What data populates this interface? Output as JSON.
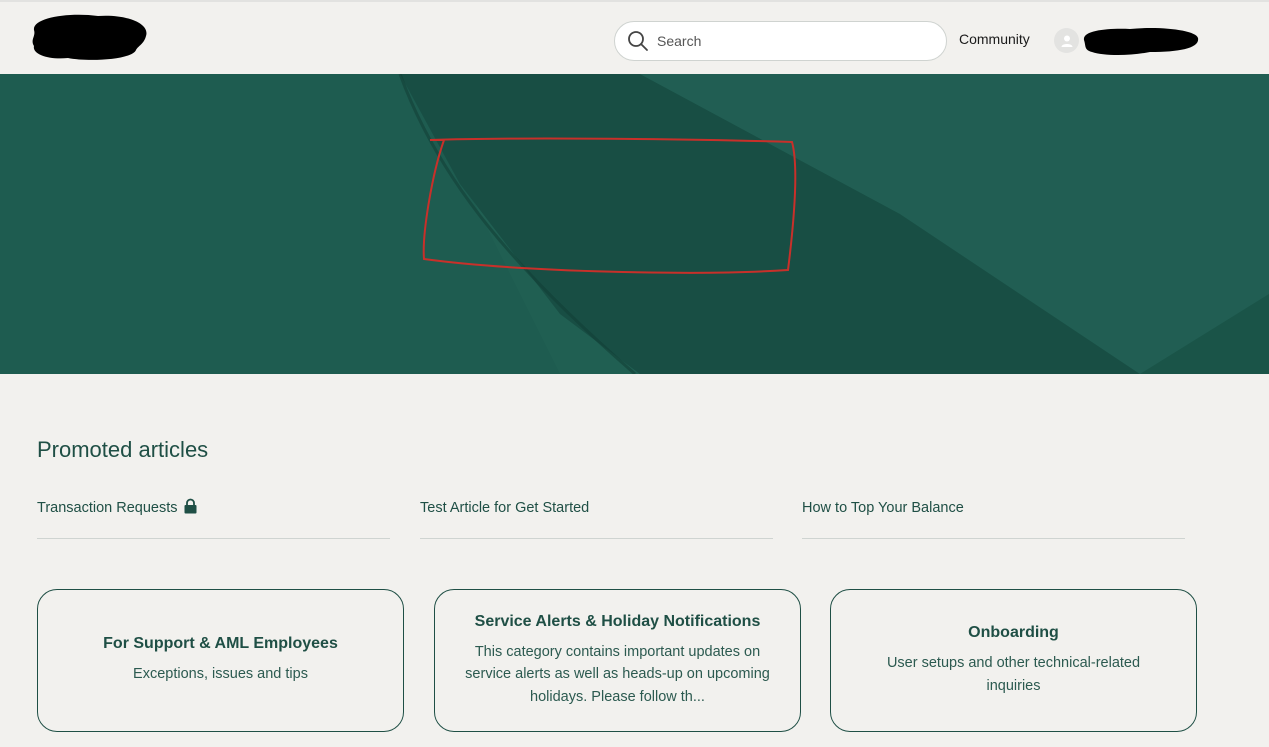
{
  "header": {
    "search_placeholder": "Search",
    "community_label": "Community",
    "icons": [
      "search-icon",
      "avatar-icon"
    ]
  },
  "promoted": {
    "title": "Promoted articles",
    "items": [
      {
        "label": "Transaction Requests",
        "locked": true
      },
      {
        "label": "Test Article for Get Started",
        "locked": false
      },
      {
        "label": "How to Top Your Balance",
        "locked": false
      }
    ]
  },
  "categories": [
    {
      "title": "For Support & AML Employees",
      "description": "Exceptions, issues and tips"
    },
    {
      "title": "Service Alerts & Holiday Notifications",
      "description": "This category contains important updates on service alerts as well as heads-up on upcoming holidays. Please follow th..."
    },
    {
      "title": "Onboarding",
      "description": "User setups and other technical-related inquiries"
    }
  ],
  "colors": {
    "brand": "#1f4f45",
    "hero_green": "#1f5e52",
    "background": "#f2f1ee",
    "annotation_red": "#c8302a"
  }
}
